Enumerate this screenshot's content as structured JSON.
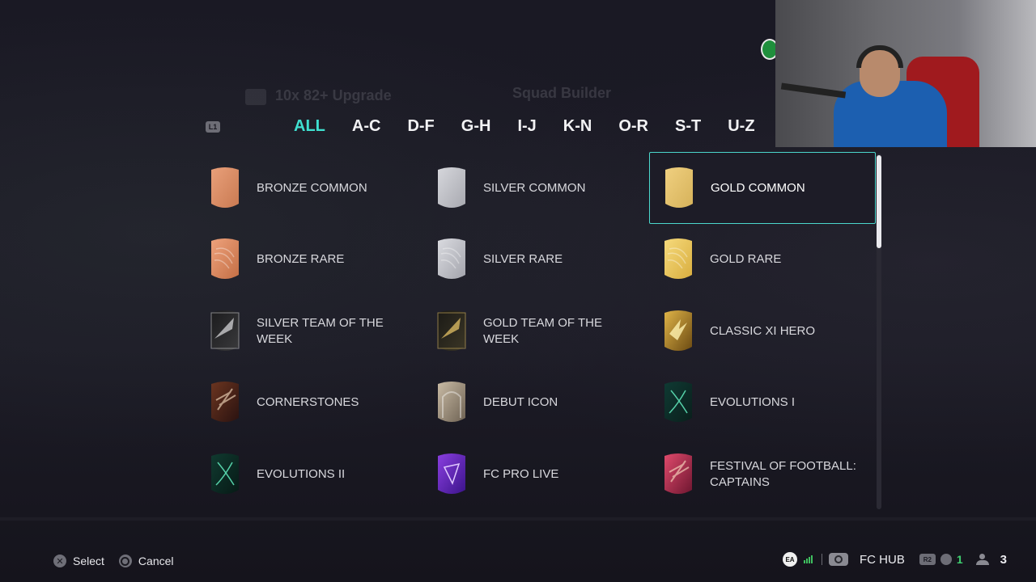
{
  "header": {
    "ghost_title": "10x 82+ Upgrade",
    "ghost_section": "Squad Builder",
    "l1_label": "L1"
  },
  "tabs": [
    {
      "label": "ALL",
      "active": true
    },
    {
      "label": "A-C"
    },
    {
      "label": "D-F"
    },
    {
      "label": "G-H"
    },
    {
      "label": "I-J"
    },
    {
      "label": "K-N"
    },
    {
      "label": "O-R"
    },
    {
      "label": "S-T"
    },
    {
      "label": "U-Z"
    }
  ],
  "items": [
    {
      "label": "BRONZE COMMON",
      "style": "bronze"
    },
    {
      "label": "SILVER COMMON",
      "style": "silver"
    },
    {
      "label": "GOLD COMMON",
      "style": "gold",
      "selected": true
    },
    {
      "label": "BRONZE RARE",
      "style": "bronze-rare"
    },
    {
      "label": "SILVER RARE",
      "style": "silver-rare"
    },
    {
      "label": "GOLD RARE",
      "style": "gold-rare"
    },
    {
      "label": "SILVER TEAM OF THE WEEK",
      "style": "totw-silver"
    },
    {
      "label": "GOLD TEAM OF THE WEEK",
      "style": "totw-gold"
    },
    {
      "label": "CLASSIC XI HERO",
      "style": "hero"
    },
    {
      "label": "CORNERSTONES",
      "style": "cornerstones"
    },
    {
      "label": "DEBUT ICON",
      "style": "debut"
    },
    {
      "label": "EVOLUTIONS I",
      "style": "evo1"
    },
    {
      "label": "EVOLUTIONS II",
      "style": "evo2"
    },
    {
      "label": "FC PRO LIVE",
      "style": "fcpro"
    },
    {
      "label": "FESTIVAL OF FOOTBALL: CAPTAINS",
      "style": "festival"
    }
  ],
  "footer": {
    "select_label": "Select",
    "cancel_label": "Cancel",
    "select_icon": "cross-button-icon",
    "cancel_icon": "circle-button-icon",
    "ea_label": "EA",
    "hub_label": "FC HUB",
    "r2_label": "R2",
    "notification_count": "1",
    "friends_count": "3"
  },
  "colors": {
    "accent": "#3fe0d0",
    "selection_border": "#4bd7cc",
    "online_green": "#3fd070"
  }
}
